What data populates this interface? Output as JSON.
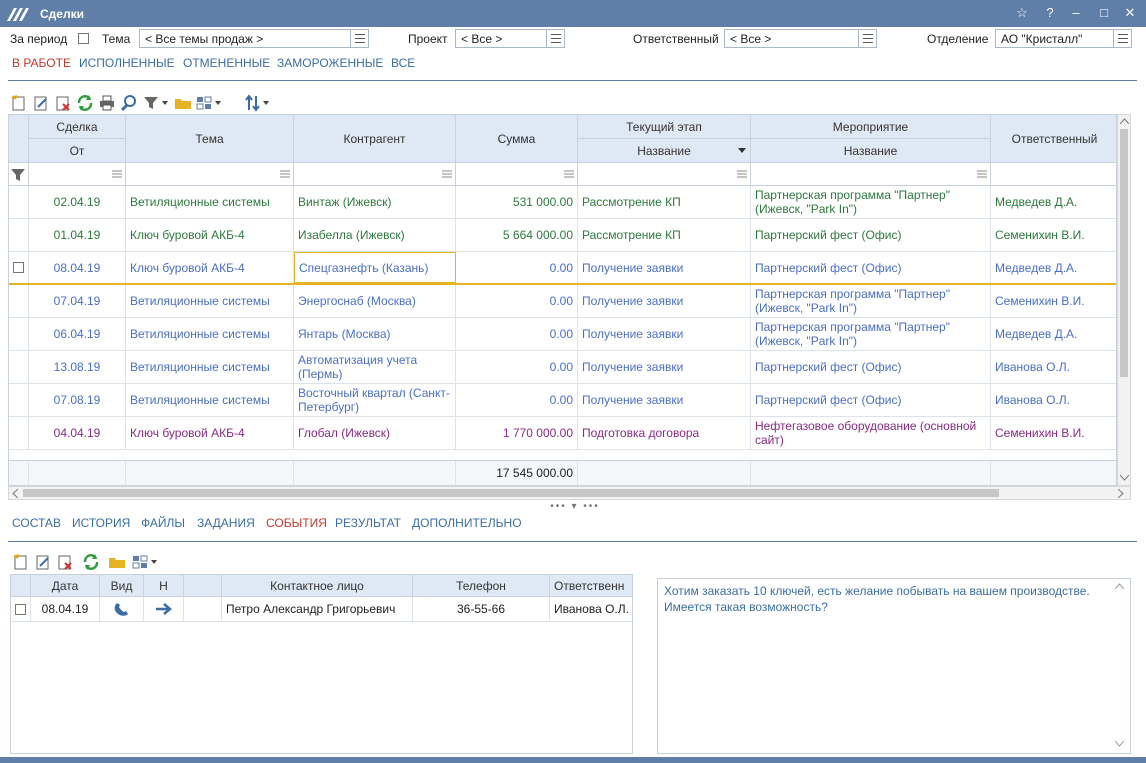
{
  "window": {
    "title": "Сделки"
  },
  "filters": {
    "period_label": "За период",
    "theme_label": "Тема",
    "theme_value": "< Все темы продаж >",
    "project_label": "Проект",
    "project_value": "< Все >",
    "responsible_label": "Ответственный",
    "responsible_value": "< Все >",
    "department_label": "Отделение",
    "department_value": "АО \"Кристалл\""
  },
  "status_tabs": [
    "В РАБОТЕ",
    "ИСПОЛНЕННЫЕ",
    "ОТМЕНЕННЫЕ",
    "ЗАМОРОЖЕННЫЕ",
    "ВСЕ"
  ],
  "grid": {
    "headers": {
      "deal": "Сделка",
      "from": "От",
      "theme": "Тема",
      "counterparty": "Контрагент",
      "sum": "Сумма",
      "stage": "Текущий этап",
      "stage_name": "Название",
      "event": "Мероприятие",
      "event_name": "Название",
      "responsible": "Ответственный"
    },
    "rows": [
      {
        "date": "02.04.19",
        "theme": "Ветиляционные системы",
        "counterparty": "Винтаж (Ижевск)",
        "sum": "531 000.00",
        "stage": "Рассмотрение КП",
        "event": "Партнерская программа \"Партнер\" (Ижевск, \"Park In\")",
        "responsible": "Медведев Д.А.",
        "color": "#2c7a3c"
      },
      {
        "date": "01.04.19",
        "theme": "Ключ буровой АКБ-4",
        "counterparty": "Изабелла (Ижевск)",
        "sum": "5 664 000.00",
        "stage": "Рассмотрение КП",
        "event": "Партнерский фест (Офис)",
        "responsible": "Семенихин В.И.",
        "color": "#2c7a3c"
      },
      {
        "date": "08.04.19",
        "theme": "Ключ буровой АКБ-4",
        "counterparty": "Спецгазнефть (Казань)",
        "sum": "0.00",
        "stage": "Получение заявки",
        "event": "Партнерский фест (Офис)",
        "responsible": "Медведев Д.А.",
        "color": "#4a6fc9"
      },
      {
        "date": "07.04.19",
        "theme": "Ветиляционные системы",
        "counterparty": "Энергоснаб (Москва)",
        "sum": "0.00",
        "stage": "Получение заявки",
        "event": "Партнерская программа \"Партнер\" (Ижевск, \"Park In\")",
        "responsible": "Семенихин В.И.",
        "color": "#4a6fc9"
      },
      {
        "date": "06.04.19",
        "theme": "Ветиляционные системы",
        "counterparty": "Янтарь (Москва)",
        "sum": "0.00",
        "stage": "Получение заявки",
        "event": "Партнерская программа \"Партнер\" (Ижевск, \"Park In\")",
        "responsible": "Медведев Д.А.",
        "color": "#4a6fc9"
      },
      {
        "date": "13.08.19",
        "theme": "Ветиляционные системы",
        "counterparty": "Автоматизация учета (Пермь)",
        "sum": "0.00",
        "stage": "Получение заявки",
        "event": "Партнерский фест (Офис)",
        "responsible": "Иванова О.Л.",
        "color": "#4a6fc9"
      },
      {
        "date": "07.08.19",
        "theme": "Ветиляционные системы",
        "counterparty": "Восточный квартал (Санкт-Петербург)",
        "sum": "0.00",
        "stage": "Получение заявки",
        "event": "Партнерский фест (Офис)",
        "responsible": "Иванова О.Л.",
        "color": "#4a6fc9"
      },
      {
        "date": "04.04.19",
        "theme": "Ключ буровой АКБ-4",
        "counterparty": "Глобал (Ижевск)",
        "sum": "1 770 000.00",
        "stage": "Подготовка договора",
        "event": "Нефтегазовое оборудование (основной сайт)",
        "responsible": "Семенихин В.И.",
        "color": "#8a2a86"
      }
    ],
    "total_sum": "17 545 000.00"
  },
  "detail_tabs": [
    "СОСТАВ",
    "ИСТОРИЯ",
    "ФАЙЛЫ",
    "ЗАДАНИЯ",
    "СОБЫТИЯ",
    "РЕЗУЛЬТАТ",
    "ДОПОЛНИТЕЛЬНО"
  ],
  "events": {
    "headers": {
      "date": "Дата",
      "kind": "Вид",
      "dir": "Н",
      "contact": "Контактное лицо",
      "phone": "Телефон",
      "responsible": "Ответственн"
    },
    "rows": [
      {
        "date": "08.04.19",
        "contact": "Петро Александр Григорьевич",
        "phone": "36-55-66",
        "responsible": "Иванова О.Л."
      }
    ]
  },
  "note": {
    "text": "Хотим заказать 10 ключей, есть желание побывать на вашем производстве. Имеется такая возможность?"
  },
  "icons": {
    "logo": "app-logo",
    "star": "☆",
    "help": "?",
    "minimize": "–",
    "maximize": "□",
    "close": "✕"
  },
  "colors": {
    "titlebar": "#5f7fa8",
    "active_tab": "#c0392b",
    "tab": "#3a6ea5",
    "header_bg": "#dfe9f5",
    "selected_border": "#e6b422"
  }
}
